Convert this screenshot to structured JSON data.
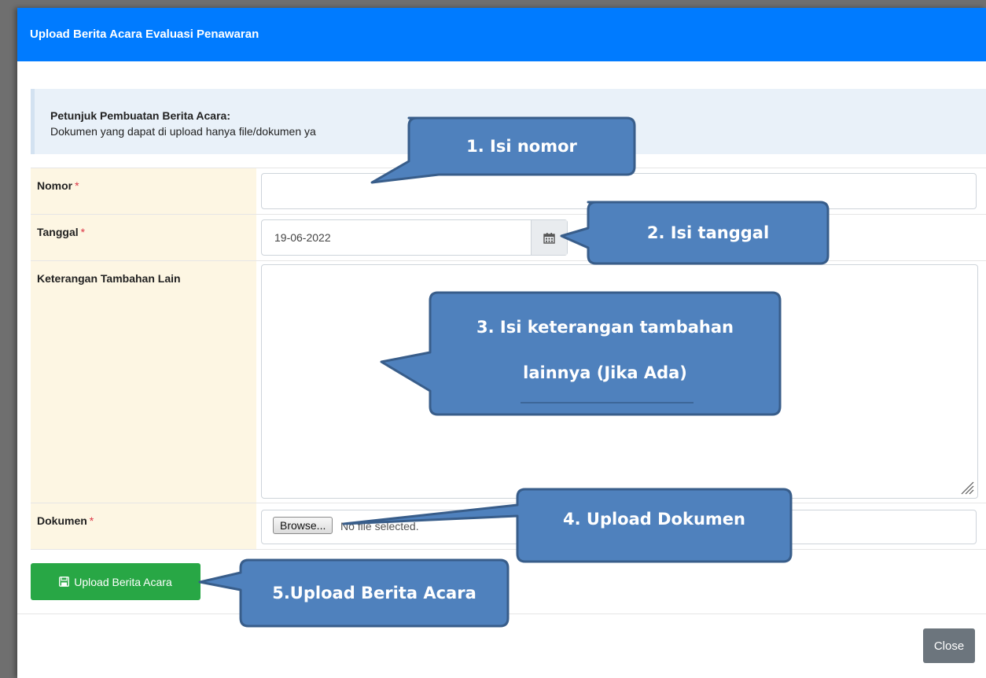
{
  "modal": {
    "title": "Upload Berita Acara Evaluasi Penawaran",
    "info": {
      "title": "Petunjuk Pembuatan Berita Acara:",
      "text": "Dokumen yang dapat di upload hanya file/dokumen ya"
    }
  },
  "form": {
    "nomor": {
      "label": "Nomor",
      "required": "*",
      "value": ""
    },
    "tanggal": {
      "label": "Tanggal",
      "required": "*",
      "value": "19-06-2022"
    },
    "keterangan": {
      "label": "Keterangan Tambahan Lain",
      "value": ""
    },
    "dokumen": {
      "label": "Dokumen",
      "required": "*",
      "browse_label": "Browse...",
      "file_status": "No file selected."
    }
  },
  "buttons": {
    "upload": {
      "label": "Upload Berita Acara",
      "icon": "save-icon",
      "color": "#28a745"
    },
    "close": {
      "label": "Close",
      "color": "#6c757d"
    }
  },
  "callouts": {
    "nomor": "1. Isi nomor",
    "tanggal": "2. Isi tanggal",
    "keterangan_line1": "3. Isi keterangan tambahan",
    "keterangan_line2": "lainnya (Jika Ada)",
    "dokumen": "4. Upload Dokumen",
    "upload": "5.Upload Berita Acara"
  },
  "colors": {
    "header": "#007bff",
    "callout_fill": "#4f81bd",
    "callout_border": "#385d8a",
    "label_bg": "#fdf6e3"
  }
}
